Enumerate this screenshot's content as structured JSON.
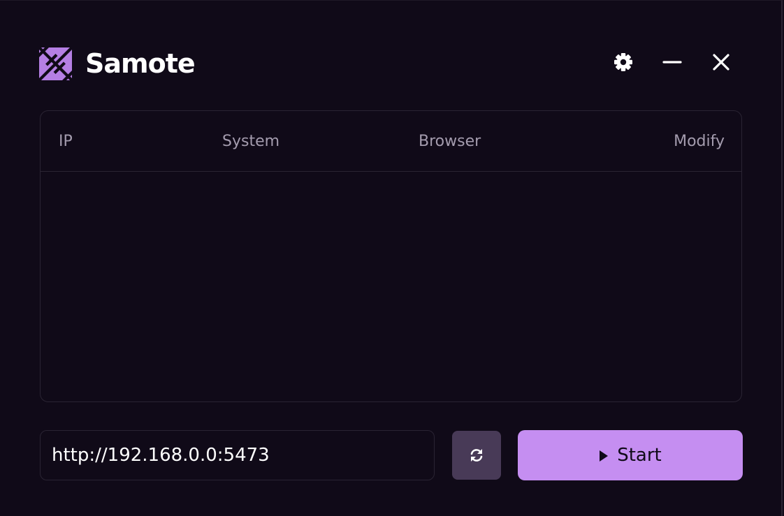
{
  "app": {
    "title": "Samote"
  },
  "window_controls": {
    "settings_icon": "gear-icon",
    "minimize_icon": "minus-icon",
    "close_icon": "close-icon"
  },
  "table": {
    "columns": [
      "IP",
      "System",
      "Browser",
      "Modify"
    ],
    "rows": []
  },
  "footer": {
    "url_value": "http://192.168.0.0:5473",
    "refresh_icon": "refresh-icon",
    "start_label": "Start",
    "start_icon": "play-icon"
  },
  "colors": {
    "background": "#100a18",
    "accent": "#c58ef1",
    "refresh_button": "#483a57",
    "border": "#2a2433",
    "header_text": "#a49cae"
  }
}
